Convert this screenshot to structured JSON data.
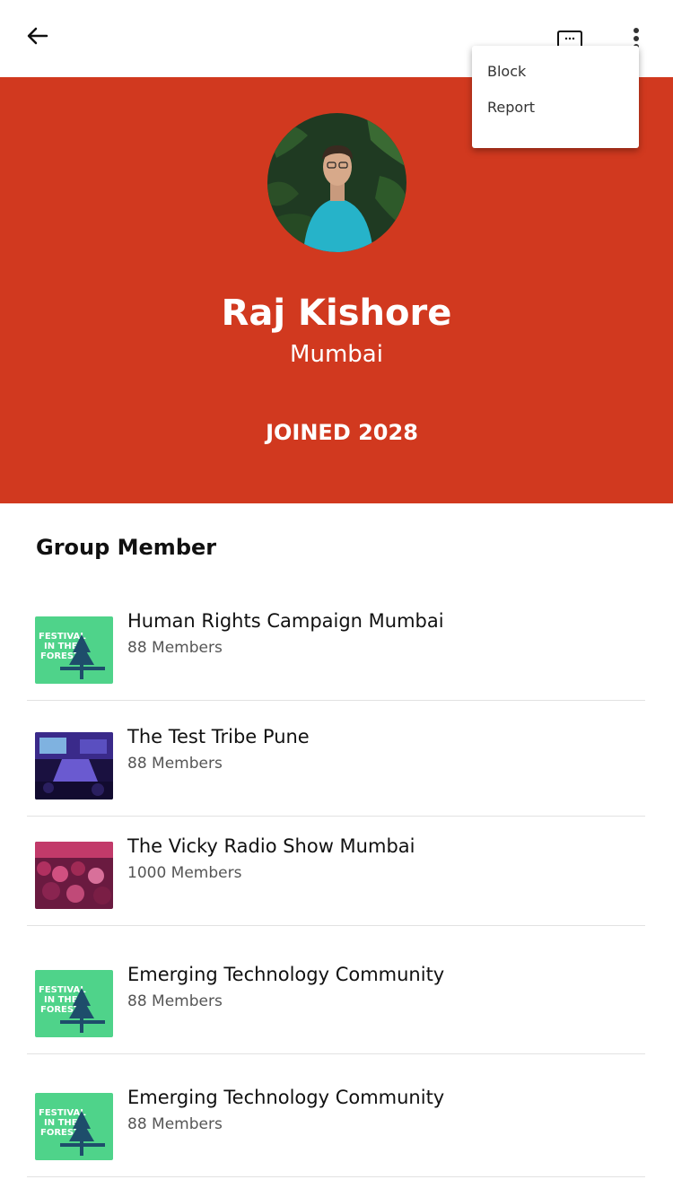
{
  "menu": {
    "block_label": "Block",
    "report_label": "Report"
  },
  "profile": {
    "name": "Raj Kishore",
    "city": "Mumbai",
    "joined": "JOINED 2028"
  },
  "colors": {
    "hero_background": "#D1391F",
    "festival_thumb": "#4FD38A"
  },
  "section_title": "Group Member",
  "groups": [
    {
      "title": "Human Rights Campaign Mumbai",
      "members": "88 Members",
      "thumb": "festival",
      "thumb_text": "FESTIVAL IN THE FOREST"
    },
    {
      "title": "The Test Tribe Pune",
      "members": "88 Members",
      "thumb": "stage-photo"
    },
    {
      "title": "The Vicky Radio Show Mumbai",
      "members": "1000 Members",
      "thumb": "crowd-photo"
    },
    {
      "title": "Emerging Technology Community",
      "members": "88 Members",
      "thumb": "festival",
      "thumb_text": "FESTIVAL IN THE FOREST"
    },
    {
      "title": "Emerging Technology Community",
      "members": "88 Members",
      "thumb": "festival",
      "thumb_text": "FESTIVAL IN THE FOREST"
    }
  ],
  "icons": {
    "back": "arrow-left-icon",
    "chat": "chat-bubble-icon",
    "more": "more-vertical-icon"
  }
}
